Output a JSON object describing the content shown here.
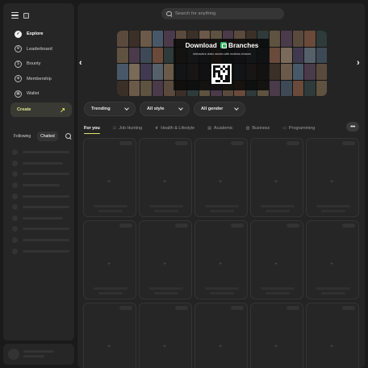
{
  "sidebar": {
    "items": [
      {
        "label": "Explore",
        "icon": "compass-icon",
        "active": true
      },
      {
        "label": "Leaderboard",
        "icon": "trophy-icon",
        "active": false
      },
      {
        "label": "Bounty",
        "icon": "dollar-icon",
        "active": false
      },
      {
        "label": "Membership",
        "icon": "shield-icon",
        "active": false
      },
      {
        "label": "Wallet",
        "icon": "wallet-icon",
        "active": false
      }
    ],
    "create_label": "Create",
    "tabs": [
      {
        "label": "Following",
        "selected": false
      },
      {
        "label": "Chatted",
        "selected": true
      }
    ],
    "placeholder_rows": 10
  },
  "header": {
    "search_placeholder": "Search for anything"
  },
  "banner": {
    "title_part1": "Download",
    "title_part2": "Branches",
    "subtitle": "Interactive video stories with endless choices"
  },
  "filters": [
    {
      "label": "Trending"
    },
    {
      "label": "All style"
    },
    {
      "label": "All gender"
    }
  ],
  "categories": [
    {
      "label": "For you",
      "icon": "",
      "active": true
    },
    {
      "label": "Job Hunting",
      "icon": "briefcase-icon",
      "active": false
    },
    {
      "label": "Health & Lifestyle",
      "icon": "leaf-icon",
      "active": false
    },
    {
      "label": "Academic",
      "icon": "book-icon",
      "active": false
    },
    {
      "label": "Business",
      "icon": "chart-icon",
      "active": false
    },
    {
      "label": "Programming",
      "icon": "code-icon",
      "active": false
    }
  ],
  "more_label": "•••",
  "grid": {
    "cards": 15
  },
  "colors": {
    "accent": "#dde56a",
    "create_text": "#dfe98b",
    "brand_green": "#35b565",
    "panel": "#242424"
  }
}
